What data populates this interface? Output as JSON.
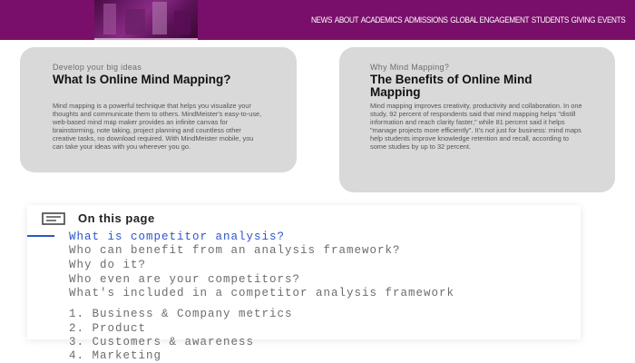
{
  "header": {
    "nav": [
      "NEWS",
      "ABOUT",
      "ACADEMICS",
      "ADMISSIONS",
      "GLOBAL ENGAGEMENT",
      "STUDENTS",
      "GIVING",
      "EVENTS"
    ],
    "brand_color": "#7a0f6b"
  },
  "cards": [
    {
      "kicker": "Develop your big ideas",
      "heading": "What Is Online Mind Mapping?",
      "body": "Mind mapping is a powerful technique that helps you visualize your thoughts and communicate them to others. MindMeister's easy-to-use, web-based mind map maker provides an infinite canvas for brainstorming, note taking, project planning and countless other creative tasks, no download required. With MindMeister mobile, you can take your ideas with you wherever you go."
    },
    {
      "kicker": "Why Mind Mapping?",
      "heading": "The Benefits of Online Mind Mapping",
      "body": "Mind mapping improves creativity, productivity and collaboration. In one study, 92 percent of respondents said that mind mapping helps \"distill information and reach clarity faster,\" while 81 percent said it helps \"manage projects more efficiently\". It's not just for business: mind maps help students improve knowledge retention and recall, according to some studies by up to 32 percent."
    }
  ],
  "toc": {
    "title": "On this page",
    "icon": "list-icon",
    "accent_color": "#2b55c8",
    "items": [
      "What is competitor analysis?",
      "Who can benefit from an analysis framework?",
      "Why do it?",
      "Who even are your competitors?",
      "What's included in a competitor analysis framework",
      "1. Business & Company metrics",
      "2. Product",
      "3. Customers & awareness",
      "4. Marketing"
    ],
    "active_index": 0
  }
}
